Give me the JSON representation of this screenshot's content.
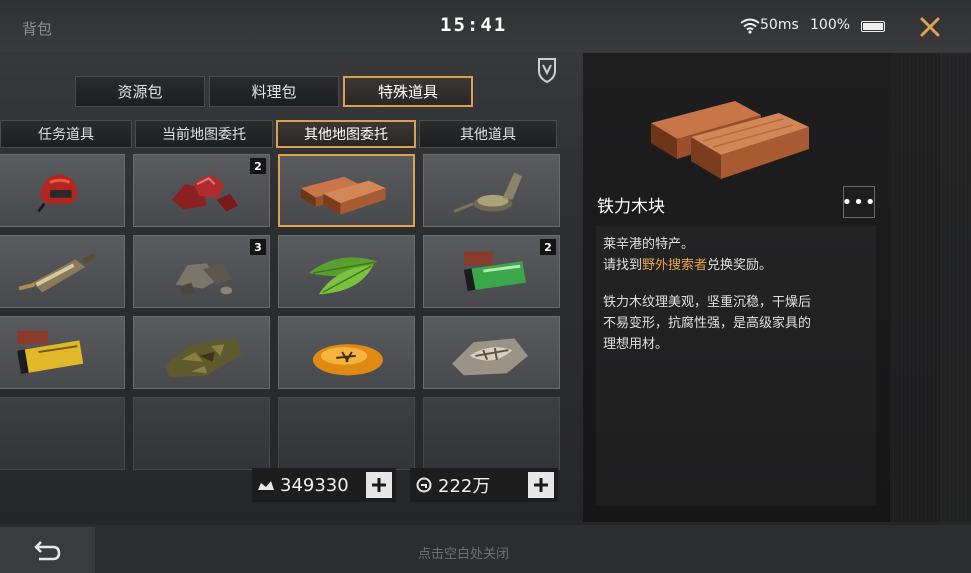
{
  "header": {
    "title": "背包",
    "time": "15:41",
    "ping": "50ms",
    "battery": "100%",
    "icons": {
      "wifi": "wifi-icon",
      "battery": "battery-icon",
      "close": "close-icon"
    },
    "accent_color": "#e0a050"
  },
  "category_tabs": [
    {
      "label": "资源包",
      "active": false
    },
    {
      "label": "料理包",
      "active": false
    },
    {
      "label": "特殊道具",
      "active": true
    }
  ],
  "sub_tabs": [
    {
      "label": "任务道具",
      "active": false
    },
    {
      "label": "当前地图委托",
      "active": false
    },
    {
      "label": "其他地图委托",
      "active": true
    },
    {
      "label": "其他道具",
      "active": false
    }
  ],
  "items": [
    {
      "icon": "red-helmet-icon",
      "count": ""
    },
    {
      "icon": "red-ore-icon",
      "count": "2"
    },
    {
      "icon": "ironwood-block-icon",
      "count": "",
      "selected": true
    },
    {
      "icon": "compass-icon",
      "count": ""
    },
    {
      "icon": "message-bottle-icon",
      "count": ""
    },
    {
      "icon": "stones-icon",
      "count": "3"
    },
    {
      "icon": "green-leaf-icon",
      "count": ""
    },
    {
      "icon": "green-battery-icon",
      "count": "2"
    },
    {
      "icon": "yellow-battery-icon",
      "count": ""
    },
    {
      "icon": "camo-cloth-icon",
      "count": ""
    },
    {
      "icon": "amber-icon",
      "count": ""
    },
    {
      "icon": "fossil-rock-icon",
      "count": ""
    }
  ],
  "currency": {
    "primary": "349330",
    "secondary": "222万"
  },
  "detail": {
    "name": "铁力木块",
    "more_label": "•••",
    "line1": "莱辛港的特产。",
    "line2_pre": "请找到",
    "line2_hl": "野外搜索者",
    "line2_post": "兑换奖励。",
    "desc_lines": [
      "铁力木纹理美观，坚重沉稳，干燥后",
      "不易变形，抗腐性强，是高级家具的",
      "理想用材。"
    ]
  },
  "footer": {
    "hint": "点击空白处关闭",
    "back_icon": "back-arrow-icon"
  }
}
